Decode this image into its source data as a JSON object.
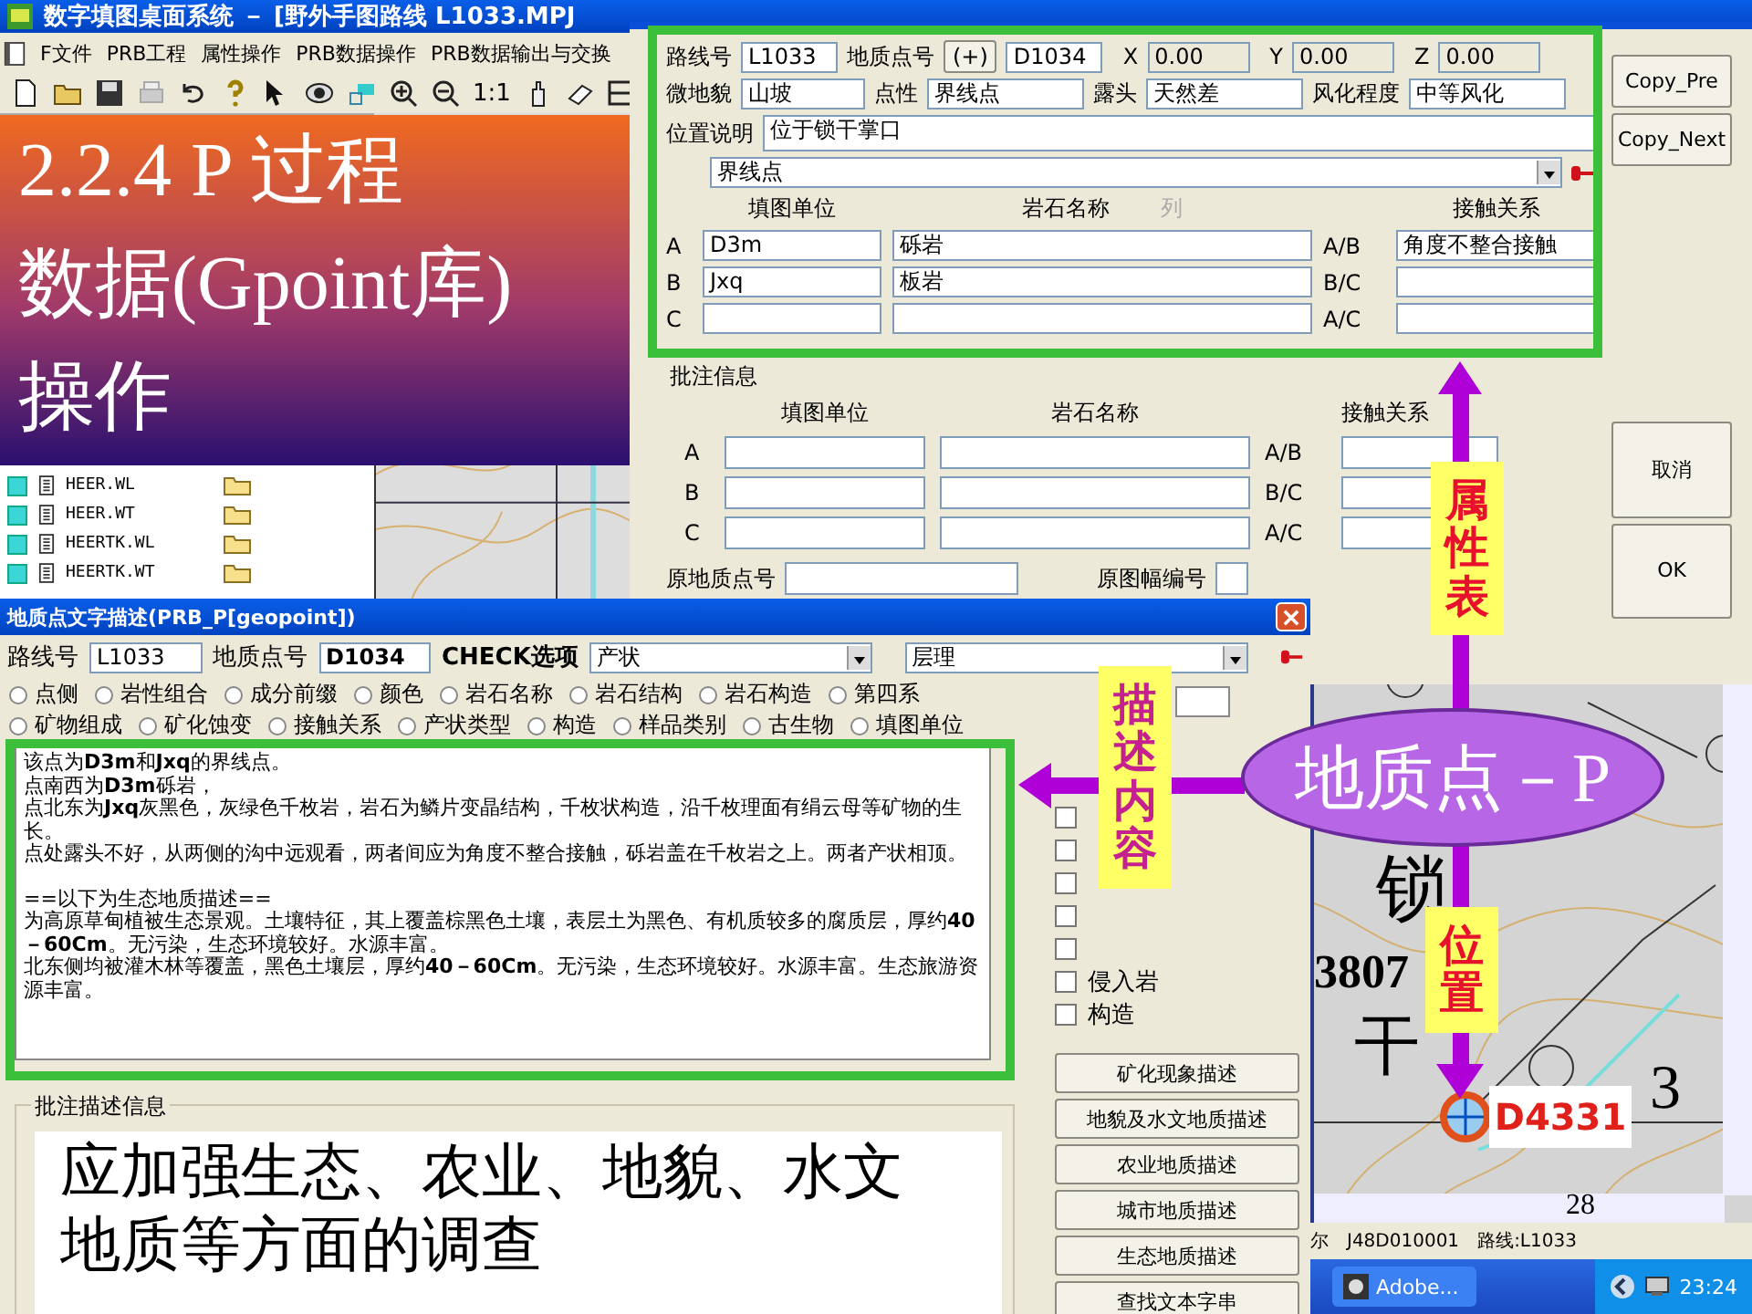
{
  "app_window": {
    "title": "数字填图桌面系统 － [野外手图路线 L1033.MPJ",
    "menu": [
      "F文件",
      "PRB工程",
      "属性操作",
      "PRB数据操作",
      "PRB数据输出与交换"
    ]
  },
  "toolbar": {
    "scale_label": "1:1"
  },
  "slide_title": [
    "2.2.4 P 过程",
    "数据(Gpoint库)",
    "操作"
  ],
  "file_list": [
    "HEER.WL",
    "HEER.WT",
    "HEERTK.WL",
    "HEERTK.WT"
  ],
  "attribute_dialog": {
    "route_label": "路线号",
    "route": "L1033",
    "point_label": "地质点号",
    "add_button": "(+)",
    "point": "D1034",
    "coords": [
      {
        "label": "X",
        "value": "0.00"
      },
      {
        "label": "Y",
        "value": "0.00"
      },
      {
        "label": "Z",
        "value": "0.00"
      }
    ],
    "attributes": [
      {
        "label": "微地貌",
        "value": "山坡"
      },
      {
        "label": "点性",
        "value": "界线点"
      },
      {
        "label": "露头",
        "value": "天然差"
      },
      {
        "label": "风化程度",
        "value": "中等风化"
      }
    ],
    "location_label": "位置说明",
    "location": "位于锁干掌口",
    "type_dropdown": "界线点",
    "columns": [
      {
        "label": "填图单位",
        "disabled": false
      },
      {
        "label": "岩石名称",
        "disabled": false
      },
      {
        "label": "列",
        "disabled": true
      },
      {
        "label": "接触关系",
        "disabled": false
      }
    ],
    "rows": [
      {
        "label": "A",
        "unit": "D3m",
        "rock": "砾岩",
        "contact_label": "A/B",
        "contact": "角度不整合接触"
      },
      {
        "label": "B",
        "unit": "Jxq",
        "rock": "板岩",
        "contact_label": "B/C"
      },
      {
        "label": "C",
        "contact_label": "A/C"
      }
    ],
    "notes": {
      "title": "批注信息",
      "columns": [
        "填图单位",
        "岩石名称",
        "接触关系"
      ],
      "rows": [
        {
          "label": "A",
          "contact_label": "A/B"
        },
        {
          "label": "B",
          "contact_label": "B/C"
        },
        {
          "label": "C",
          "contact_label": "A/C"
        }
      ],
      "original_point_label": "原地质点号",
      "original_sheet_label": "原图幅编号"
    },
    "copy_buttons": [
      "Copy_Pre",
      "Copy_Next"
    ],
    "buttons": [
      "取消",
      "OK"
    ]
  },
  "description_dialog": {
    "title": "地质点文字描述(PRB_P[geopoint])",
    "route_label": "路线号",
    "route": "L1033",
    "point_label": "地质点号",
    "point": "D1034",
    "check_label": "CHECK选项",
    "check_value": "产状",
    "check_value_2": "层理",
    "option_rows": [
      [
        {
          "label": "点侧",
          "selected": false
        },
        {
          "label": "岩性组合",
          "selected": false
        },
        {
          "label": "成分前缀",
          "selected": false
        },
        {
          "label": "颜色",
          "selected": false
        },
        {
          "label": "岩石名称",
          "selected": false
        },
        {
          "label": "岩石结构",
          "selected": false
        },
        {
          "label": "岩石构造",
          "selected": false
        },
        {
          "label": "第四系",
          "selected": false
        }
      ],
      [
        {
          "label": "矿物组成",
          "selected": false
        },
        {
          "label": "矿化蚀变",
          "selected": false
        },
        {
          "label": "接触关系",
          "selected": false
        },
        {
          "label": "产状类型",
          "selected": false
        },
        {
          "label": "构造",
          "selected": false
        },
        {
          "label": "样品类别",
          "selected": false
        },
        {
          "label": "古生物",
          "selected": false
        },
        {
          "label": "填图单位",
          "selected": false
        }
      ]
    ],
    "description": [
      [
        "该点为**D3m**和**Jxq**的界线点。",
        "点南西为**D3m**砾岩，",
        "点北东为**Jxq**灰黑色，灰绿色千枚岩，岩石为鳞片变晶结构，千枚状构造，沿千枚理面有绢云母等矿物的生长。",
        "点处露头不好，从两侧的沟中远观看，两者间应为角度不整合接触，砾岩盖在千枚岩之上。两者产状相顶。"
      ],
      [
        "==以下为生态地质描述==",
        "为高原草甸植被生态景观。土壤特征，其上覆盖棕黑色土壤，表层土为黑色、有机质较多的腐质层，厚约**40－60Cm**。无污染，生态环境较好。水源丰富。",
        "北东侧均被灌木林等覆盖，黑色土壤层，厚约**40－60Cm**。无污染，生态环境较好。水源丰富。生态旅游资源丰富。"
      ]
    ],
    "checkboxes": [
      {
        "checked": false
      },
      {
        "checked": false
      },
      {
        "checked": false
      },
      {
        "checked": false
      },
      {
        "checked": false
      },
      {
        "label": "侵入岩",
        "checked": false
      },
      {
        "label": "构造",
        "checked": false
      }
    ],
    "buttons": [
      "矿化现象描述",
      "地貌及水文地质描述",
      "农业地质描述",
      "城市地质描述",
      "生态地质描述",
      "查找文本字串"
    ],
    "notes_title": "批注描述信息",
    "notes": "应加强生态、农业、地貌、水文地质等方面的调查"
  },
  "map": {
    "labels": [
      "锁",
      "3807",
      "干",
      "3"
    ],
    "point_label": "D4331"
  },
  "status_bar": [
    "尔",
    "J48D010001",
    "路线:L1033"
  ],
  "taskbar": {
    "app": "Adobe...",
    "clock": "23:24"
  },
  "callouts": {
    "center": "地质点－P",
    "labels": [
      {
        "text": "属性表",
        "color": "#e8112d"
      },
      {
        "text": "描述内容",
        "color": "#c4208f"
      },
      {
        "text": "位置",
        "color": "#e8112d"
      }
    ]
  },
  "page_number": "28"
}
